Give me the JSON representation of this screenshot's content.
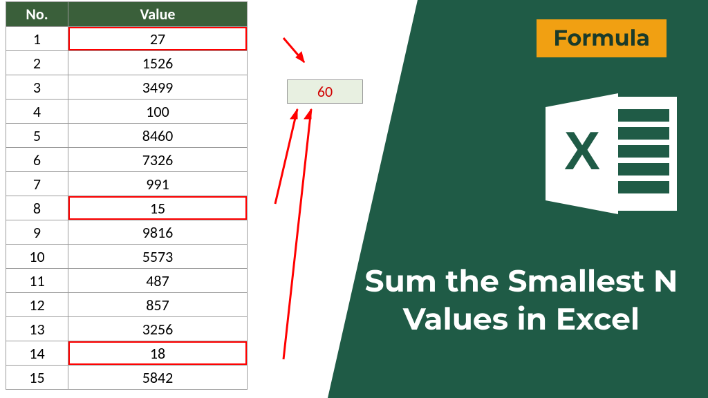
{
  "table": {
    "headers": {
      "no": "No.",
      "value": "Value"
    },
    "rows": [
      {
        "no": "1",
        "value": "27",
        "highlighted": true
      },
      {
        "no": "2",
        "value": "1526",
        "highlighted": false
      },
      {
        "no": "3",
        "value": "3499",
        "highlighted": false
      },
      {
        "no": "4",
        "value": "100",
        "highlighted": false
      },
      {
        "no": "5",
        "value": "8460",
        "highlighted": false
      },
      {
        "no": "6",
        "value": "7326",
        "highlighted": false
      },
      {
        "no": "7",
        "value": "991",
        "highlighted": false
      },
      {
        "no": "8",
        "value": "15",
        "highlighted": true
      },
      {
        "no": "9",
        "value": "9816",
        "highlighted": false
      },
      {
        "no": "10",
        "value": "5573",
        "highlighted": false
      },
      {
        "no": "11",
        "value": "487",
        "highlighted": false
      },
      {
        "no": "12",
        "value": "857",
        "highlighted": false
      },
      {
        "no": "13",
        "value": "3256",
        "highlighted": false
      },
      {
        "no": "14",
        "value": "18",
        "highlighted": true
      },
      {
        "no": "15",
        "value": "5842",
        "highlighted": false
      }
    ]
  },
  "result": "60",
  "badge": "Formula",
  "title": "Sum the Smallest N Values in Excel",
  "colors": {
    "header_bg": "#3a5f3a",
    "badge_bg": "#f1a012",
    "panel_bg": "#1f5b46"
  }
}
